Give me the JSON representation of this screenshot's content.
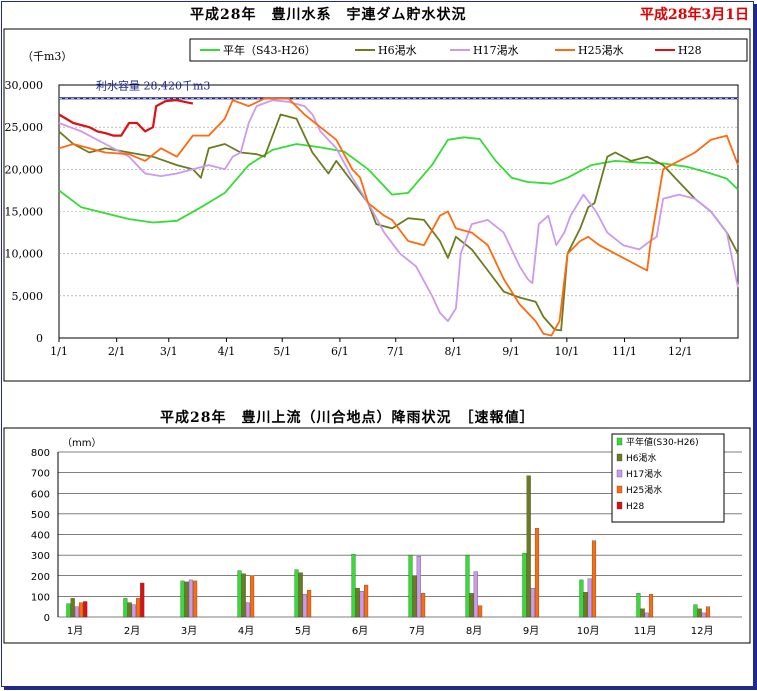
{
  "header": {
    "title": "平成28年　豊川水系　宇連ダム貯水状況",
    "date": "平成28年3月1日"
  },
  "storage_chart_title": "",
  "rain_chart_title": "平成28年　豊川上流（川合地点）降雨状況　［速報値］",
  "colors": {
    "normal": "#33dd33",
    "h6": "#6b7b1e",
    "h17": "#cc99ee",
    "h25": "#ff6a0d",
    "h28": "#dd1111",
    "capacity": "#1f2a8a"
  },
  "chart_data": [
    {
      "type": "line",
      "ylabel": "（千m3）",
      "ylim": [
        0,
        30000
      ],
      "yticks": [
        "0",
        "5,000",
        "10,000",
        "15,000",
        "20,000",
        "25,000",
        "30,000"
      ],
      "xticks": [
        "1/1",
        "2/1",
        "3/1",
        "4/1",
        "5/1",
        "6/1",
        "7/1",
        "8/1",
        "9/1",
        "10/1",
        "11/1",
        "12/1"
      ],
      "capacity_label": "利水容量 28,420千m3",
      "capacity": 28420,
      "series": [
        {
          "name": "平年（S43-H26）",
          "key": "normal",
          "points": [
            [
              1,
              17500
            ],
            [
              15,
              15500
            ],
            [
              30,
              14800
            ],
            [
              45,
              14100
            ],
            [
              60,
              13700
            ],
            [
              75,
              13900
            ],
            [
              90,
              15500
            ],
            [
              105,
              17200
            ],
            [
              120,
              20500
            ],
            [
              135,
              22300
            ],
            [
              150,
              23000
            ],
            [
              165,
              22600
            ],
            [
              180,
              22100
            ],
            [
              195,
              20000
            ],
            [
              210,
              17000
            ],
            [
              220,
              17200
            ],
            [
              235,
              20500
            ],
            [
              245,
              23500
            ],
            [
              255,
              23800
            ],
            [
              265,
              23600
            ],
            [
              275,
              21000
            ],
            [
              285,
              19000
            ],
            [
              295,
              18500
            ],
            [
              310,
              18300
            ],
            [
              320,
              19000
            ],
            [
              335,
              20500
            ],
            [
              350,
              21000
            ],
            [
              365,
              20800
            ],
            [
              380,
              20700
            ],
            [
              395,
              20300
            ],
            [
              410,
              19500
            ],
            [
              420,
              18900
            ],
            [
              427,
              17600
            ]
          ]
        },
        {
          "name": "H6渇水",
          "key": "h6",
          "points": [
            [
              1,
              24500
            ],
            [
              10,
              23000
            ],
            [
              20,
              22000
            ],
            [
              30,
              22500
            ],
            [
              45,
              22000
            ],
            [
              60,
              21500
            ],
            [
              75,
              20500
            ],
            [
              85,
              20000
            ],
            [
              90,
              19000
            ],
            [
              95,
              22500
            ],
            [
              105,
              23000
            ],
            [
              115,
              22000
            ],
            [
              125,
              21800
            ],
            [
              130,
              21500
            ],
            [
              140,
              26500
            ],
            [
              150,
              26000
            ],
            [
              160,
              22000
            ],
            [
              170,
              19500
            ],
            [
              175,
              21000
            ],
            [
              185,
              18500
            ],
            [
              195,
              16000
            ],
            [
              200,
              13500
            ],
            [
              210,
              13000
            ],
            [
              220,
              14200
            ],
            [
              230,
              14000
            ],
            [
              240,
              11500
            ],
            [
              245,
              9500
            ],
            [
              250,
              12000
            ],
            [
              260,
              10500
            ],
            [
              270,
              8000
            ],
            [
              280,
              5500
            ],
            [
              290,
              4800
            ],
            [
              300,
              4300
            ],
            [
              305,
              2500
            ],
            [
              312,
              1000
            ],
            [
              316,
              900
            ],
            [
              320,
              10000
            ],
            [
              328,
              13000
            ],
            [
              333,
              15500
            ],
            [
              337,
              16000
            ],
            [
              345,
              21500
            ],
            [
              350,
              22000
            ],
            [
              360,
              21000
            ],
            [
              370,
              21500
            ],
            [
              380,
              20500
            ],
            [
              390,
              18500
            ],
            [
              400,
              16500
            ],
            [
              410,
              15000
            ],
            [
              420,
              12500
            ],
            [
              427,
              10000
            ]
          ]
        },
        {
          "name": "H17渇水",
          "key": "h17",
          "points": [
            [
              1,
              25500
            ],
            [
              15,
              24500
            ],
            [
              30,
              23000
            ],
            [
              45,
              21500
            ],
            [
              55,
              19500
            ],
            [
              65,
              19200
            ],
            [
              75,
              19500
            ],
            [
              85,
              20000
            ],
            [
              95,
              20500
            ],
            [
              105,
              20000
            ],
            [
              110,
              21500
            ],
            [
              115,
              22000
            ],
            [
              120,
              25500
            ],
            [
              125,
              27500
            ],
            [
              135,
              28200
            ],
            [
              145,
              28000
            ],
            [
              155,
              27500
            ],
            [
              160,
              26500
            ],
            [
              165,
              24500
            ],
            [
              175,
              22500
            ],
            [
              185,
              19000
            ],
            [
              195,
              16000
            ],
            [
              205,
              12500
            ],
            [
              215,
              10000
            ],
            [
              225,
              8500
            ],
            [
              235,
              5000
            ],
            [
              240,
              3000
            ],
            [
              245,
              2000
            ],
            [
              250,
              3500
            ],
            [
              253,
              10000
            ],
            [
              260,
              13500
            ],
            [
              270,
              14000
            ],
            [
              280,
              12500
            ],
            [
              290,
              8500
            ],
            [
              295,
              7000
            ],
            [
              298,
              6500
            ],
            [
              302,
              13500
            ],
            [
              308,
              14500
            ],
            [
              313,
              11000
            ],
            [
              318,
              12500
            ],
            [
              322,
              14500
            ],
            [
              330,
              17000
            ],
            [
              338,
              15000
            ],
            [
              345,
              12500
            ],
            [
              355,
              11000
            ],
            [
              365,
              10500
            ],
            [
              372,
              11500
            ],
            [
              376,
              12000
            ],
            [
              380,
              16500
            ],
            [
              390,
              17000
            ],
            [
              400,
              16500
            ],
            [
              410,
              15000
            ],
            [
              420,
              12500
            ],
            [
              427,
              6000
            ]
          ]
        },
        {
          "name": "H25渇水",
          "key": "h25",
          "points": [
            [
              1,
              22500
            ],
            [
              10,
              23000
            ],
            [
              20,
              22500
            ],
            [
              30,
              22000
            ],
            [
              45,
              21800
            ],
            [
              55,
              21000
            ],
            [
              65,
              22500
            ],
            [
              75,
              21500
            ],
            [
              85,
              24000
            ],
            [
              95,
              24000
            ],
            [
              105,
              26000
            ],
            [
              110,
              28200
            ],
            [
              120,
              27500
            ],
            [
              130,
              28400
            ],
            [
              145,
              28400
            ],
            [
              155,
              26500
            ],
            [
              165,
              25000
            ],
            [
              175,
              23500
            ],
            [
              185,
              20000
            ],
            [
              190,
              19000
            ],
            [
              195,
              16000
            ],
            [
              205,
              14500
            ],
            [
              210,
              14000
            ],
            [
              220,
              11500
            ],
            [
              230,
              11000
            ],
            [
              240,
              14500
            ],
            [
              245,
              15000
            ],
            [
              250,
              13000
            ],
            [
              260,
              12500
            ],
            [
              270,
              11000
            ],
            [
              280,
              7000
            ],
            [
              290,
              4000
            ],
            [
              300,
              2000
            ],
            [
              305,
              500
            ],
            [
              310,
              300
            ],
            [
              315,
              2000
            ],
            [
              320,
              10000
            ],
            [
              328,
              11500
            ],
            [
              333,
              12000
            ],
            [
              340,
              11000
            ],
            [
              350,
              10000
            ],
            [
              360,
              9000
            ],
            [
              370,
              8000
            ],
            [
              372,
              11000
            ],
            [
              380,
              20000
            ],
            [
              390,
              21000
            ],
            [
              400,
              22000
            ],
            [
              410,
              23500
            ],
            [
              420,
              24000
            ],
            [
              427,
              20500
            ]
          ]
        },
        {
          "name": "H28",
          "key": "h28",
          "points": [
            [
              1,
              26500
            ],
            [
              10,
              25500
            ],
            [
              20,
              25000
            ],
            [
              25,
              24500
            ],
            [
              30,
              24300
            ],
            [
              35,
              24000
            ],
            [
              40,
              24000
            ],
            [
              45,
              25500
            ],
            [
              50,
              25500
            ],
            [
              55,
              24500
            ],
            [
              60,
              25000
            ],
            [
              62,
              27500
            ],
            [
              68,
              28100
            ],
            [
              75,
              28200
            ],
            [
              80,
              28000
            ],
            [
              85,
              27800
            ]
          ]
        }
      ]
    },
    {
      "type": "bar",
      "ylabel": "（mm）",
      "ylim": [
        0,
        800
      ],
      "yticks": [
        "0",
        "100",
        "200",
        "300",
        "400",
        "500",
        "600",
        "700",
        "800"
      ],
      "categories": [
        "1月",
        "2月",
        "3月",
        "4月",
        "5月",
        "6月",
        "7月",
        "8月",
        "9月",
        "10月",
        "11月",
        "12月"
      ],
      "series": [
        {
          "name": "平年値(S30-H26)",
          "key": "normal",
          "values": [
            65,
            90,
            175,
            225,
            230,
            305,
            300,
            300,
            310,
            180,
            115,
            60
          ]
        },
        {
          "name": "H6渇水",
          "key": "h6",
          "values": [
            90,
            70,
            170,
            210,
            215,
            140,
            200,
            115,
            685,
            120,
            40,
            40
          ]
        },
        {
          "name": "H17渇水",
          "key": "h17",
          "values": [
            50,
            60,
            180,
            70,
            110,
            125,
            295,
            220,
            140,
            185,
            20,
            20
          ]
        },
        {
          "name": "H25渇水",
          "key": "h25",
          "values": [
            70,
            90,
            175,
            200,
            130,
            155,
            115,
            55,
            430,
            370,
            110,
            50
          ]
        },
        {
          "name": "H28",
          "key": "h28",
          "values": [
            75,
            165,
            null,
            null,
            null,
            null,
            null,
            null,
            null,
            null,
            null,
            null
          ]
        }
      ]
    }
  ]
}
